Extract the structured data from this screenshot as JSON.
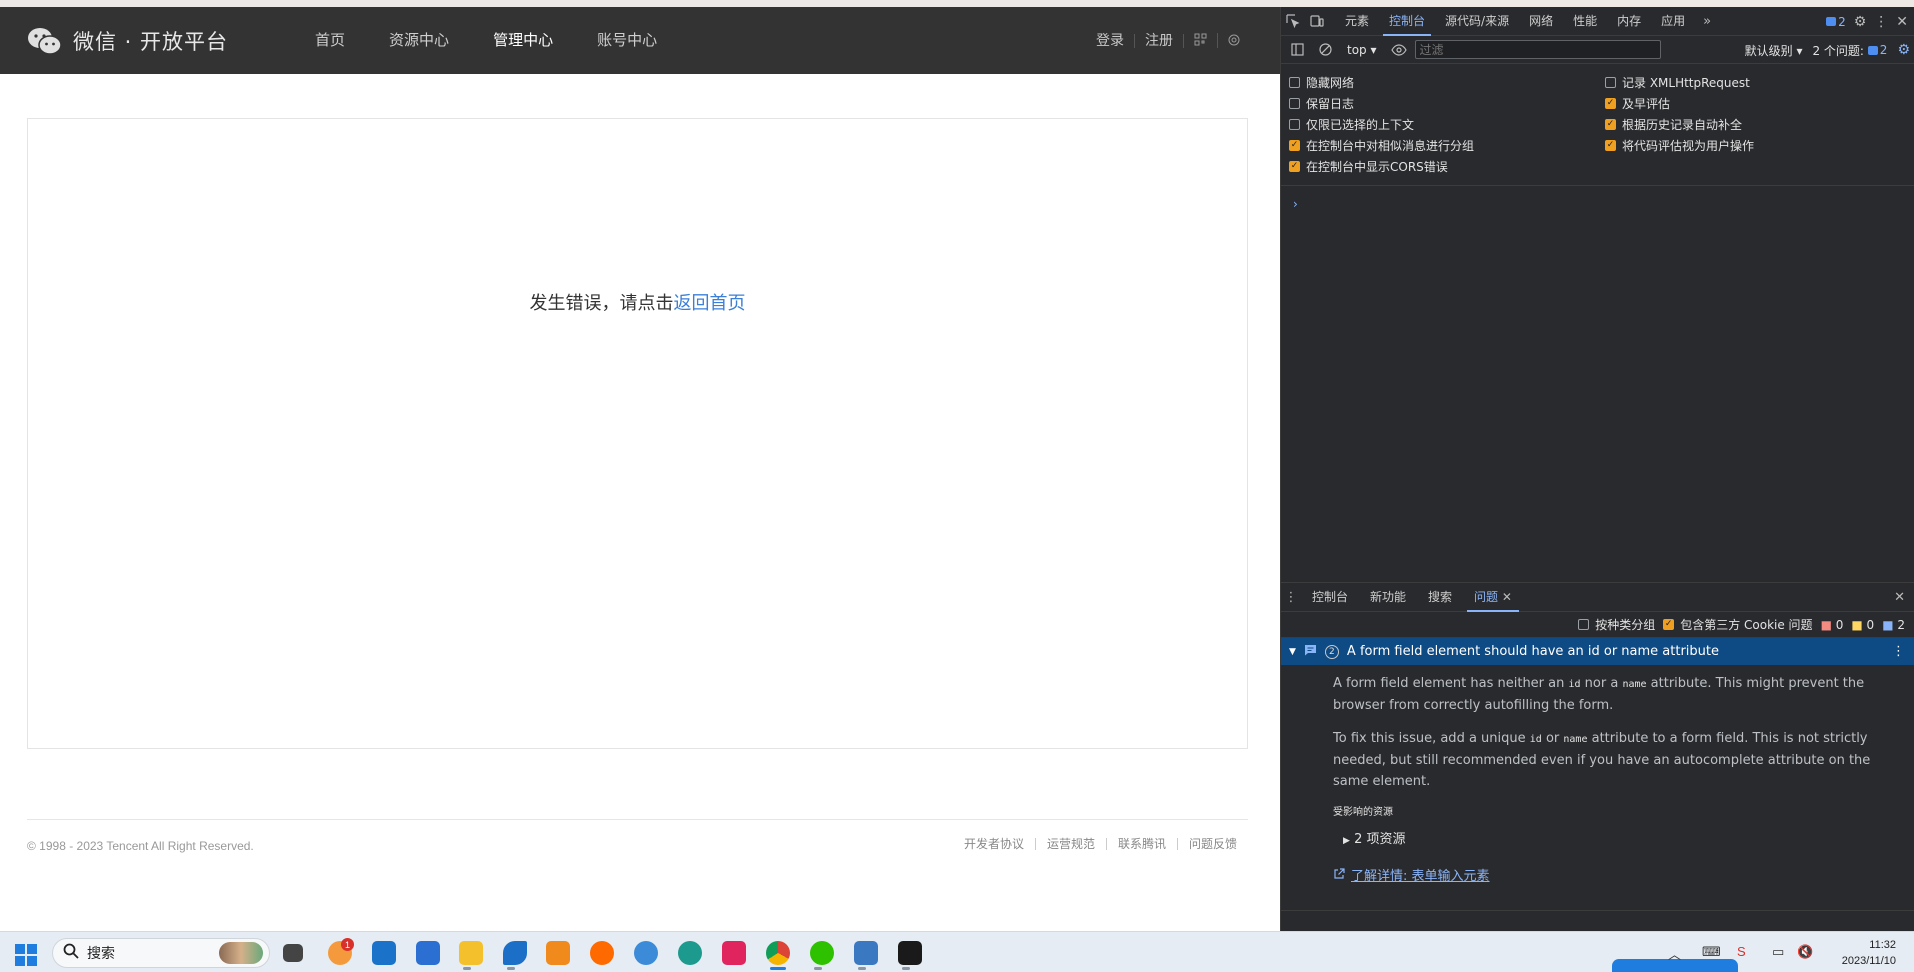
{
  "page": {
    "logo_text": "微信 · 开放平台",
    "nav": [
      {
        "label": "首页",
        "active": false
      },
      {
        "label": "资源中心",
        "active": false
      },
      {
        "label": "管理中心",
        "active": true
      },
      {
        "label": "账号中心",
        "active": false
      }
    ],
    "header_right": {
      "login": "登录",
      "register": "注册"
    },
    "error_prefix": "发生错误，请点击",
    "error_link": "返回首页",
    "copyright": "© 1998 - 2023 Tencent All Right Reserved.",
    "footer_links": [
      "开发者协议",
      "运营规范",
      "联系腾讯",
      "问题反馈"
    ]
  },
  "devtools": {
    "tabs": [
      {
        "label": "元素",
        "active": false
      },
      {
        "label": "控制台",
        "active": true
      },
      {
        "label": "源代码/来源",
        "active": false
      },
      {
        "label": "网络",
        "active": false
      },
      {
        "label": "性能",
        "active": false
      },
      {
        "label": "内存",
        "active": false
      },
      {
        "label": "应用",
        "active": false
      }
    ],
    "issue_badge": "2",
    "context": "top",
    "filter_placeholder": "过滤",
    "level": "默认级别",
    "issues_label": "2 个问题:",
    "issues_count": "2",
    "settings_left": [
      {
        "label": "隐藏网络",
        "checked": false
      },
      {
        "label": "保留日志",
        "checked": false
      },
      {
        "label": "仅限已选择的上下文",
        "checked": false
      },
      {
        "label": "在控制台中对相似消息进行分组",
        "checked": true
      },
      {
        "label": "在控制台中显示CORS错误",
        "checked": true
      }
    ],
    "settings_right": [
      {
        "label": "记录 XMLHttpRequest",
        "checked": false
      },
      {
        "label": "及早评估",
        "checked": true
      },
      {
        "label": "根据历史记录自动补全",
        "checked": true
      },
      {
        "label": "将代码评估视为用户操作",
        "checked": true
      }
    ],
    "drawer": {
      "tabs": [
        {
          "label": "控制台",
          "active": false
        },
        {
          "label": "新功能",
          "active": false
        },
        {
          "label": "搜索",
          "active": false
        },
        {
          "label": "问题",
          "active": true
        }
      ],
      "group_by_kind": "按种类分组",
      "include_third_party": "包含第三方 Cookie 问题",
      "counts": {
        "errors": "0",
        "warnings": "0",
        "info": "2"
      },
      "issue": {
        "count": "2",
        "title": "A form field element should have an id or name attribute",
        "p1_a": "A form field element has neither an ",
        "p1_id": "id",
        "p1_b": " nor a ",
        "p1_name": "name",
        "p1_c": " attribute. This might prevent the browser from correctly autofilling the form.",
        "p2_a": "To fix this issue, add a unique ",
        "p2_id": "id",
        "p2_b": " or ",
        "p2_name": "name",
        "p2_c": " attribute to a form field. This is not strictly needed, but still recommended even if you have an autocomplete attribute on the same element.",
        "affected": "受影响的资源",
        "resources": "2 项资源",
        "learn_more": "了解详情: 表单输入元素"
      }
    }
  },
  "taskbar": {
    "search_label": "搜索",
    "mail_badge": "1",
    "time": "11:32",
    "date": "2023/11/10"
  }
}
